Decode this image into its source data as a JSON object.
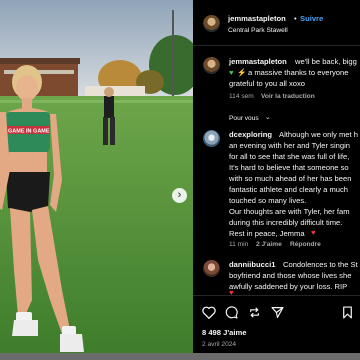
{
  "colors": {
    "accent": "#4ea1f6",
    "like": "#ff3040",
    "background": "#000000"
  },
  "photo": {
    "shirt_text": "GAME IN GAME",
    "next_icon": "chevron-right-icon"
  },
  "header": {
    "username": "jemmastapleton",
    "separator": "•",
    "follow": "Suivre",
    "location": "Central Park Stawell"
  },
  "caption": {
    "username": "jemmastapleton",
    "line1": "we'll be back, bigg",
    "line2": "a massive thanks to everyone",
    "line3": "grateful to you all xoxo",
    "time": "114 sem",
    "translate": "Voir la traduction"
  },
  "section": {
    "label": "Pour vous",
    "icon": "chevron-down-icon"
  },
  "comment1": {
    "username": "dcexploring",
    "lines": [
      "Although we only met h",
      "an evening with her and Tyler singin",
      "for all to see that she was full of life,",
      "It's hard to believe that someone so",
      "with so much ahead of her has been",
      "fantastic athlete and clearly a much",
      "touched so many lives.",
      "Our thoughts are with Tyler, her fam",
      "during this incredibly difficult time.",
      "Rest in peace, Jemma"
    ],
    "time": "11 min",
    "likes": "2 J'aime",
    "reply": "Répondre"
  },
  "comment2": {
    "username": "danniibucci1",
    "lines": [
      "Condolences to the St",
      "boyfriend and those whose lives she",
      "awfully saddened by your loss. RIP"
    ]
  },
  "stats": {
    "likes": "8 498 J'aime",
    "date": "2 avril 2024"
  }
}
